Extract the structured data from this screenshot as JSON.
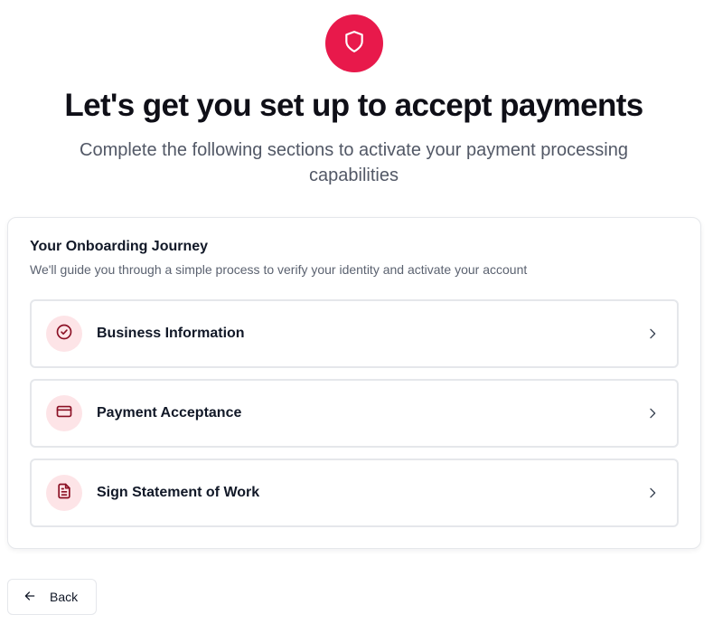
{
  "hero": {
    "icon": "shield-icon",
    "title": "Let's get you set up to accept payments",
    "subtitle": "Complete the following sections to activate your payment processing capabilities"
  },
  "journey": {
    "title": "Your Onboarding Journey",
    "description": "We'll guide you through a simple process to verify your identity and activate your account",
    "steps": [
      {
        "label": "Business Information",
        "icon": "check-circle-icon"
      },
      {
        "label": "Payment Acceptance",
        "icon": "credit-card-icon"
      },
      {
        "label": "Sign Statement of Work",
        "icon": "document-icon"
      }
    ]
  },
  "footer": {
    "back_label": "Back",
    "back_icon": "arrow-left-icon"
  },
  "colors": {
    "brand": "#e8194b",
    "icon_bg": "#fde4e7",
    "icon_fg": "#8b1024",
    "border": "#e5e7eb"
  }
}
